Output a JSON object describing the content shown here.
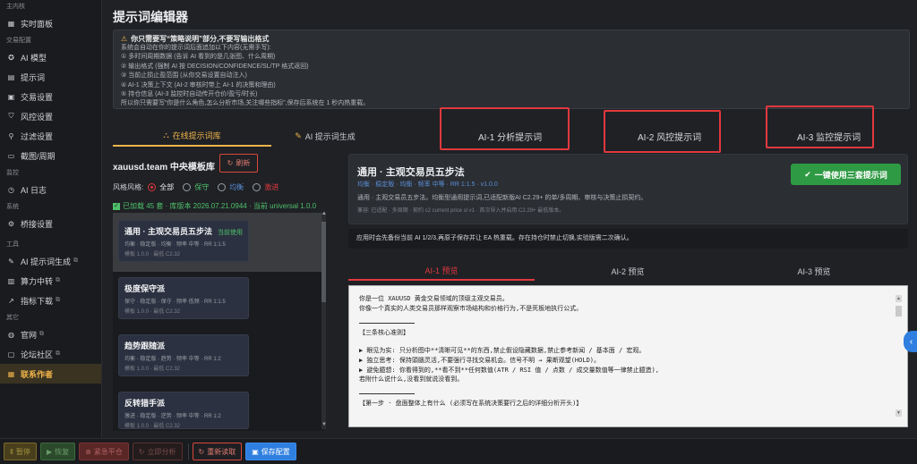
{
  "sidebar": {
    "sections": [
      "主内核",
      "交易配置",
      "监控",
      "系统",
      "工具",
      "其它"
    ],
    "items": [
      {
        "label": "实时面板",
        "icon": "dashboard-icon"
      },
      {
        "label": "AI 模型",
        "icon": "ai-icon"
      },
      {
        "label": "提示词",
        "icon": "file-icon"
      },
      {
        "label": "交易设置",
        "icon": "briefcase-icon"
      },
      {
        "label": "风控设置",
        "icon": "shield-icon"
      },
      {
        "label": "过滤设置",
        "icon": "filter-icon"
      },
      {
        "label": "截图/周期",
        "icon": "screenshot-icon"
      },
      {
        "label": "AI 日志",
        "icon": "log-icon"
      },
      {
        "label": "桥接设置",
        "icon": "gear-icon"
      },
      {
        "label": "AI 提示词生成",
        "icon": "wand-icon"
      },
      {
        "label": "算力中转",
        "icon": "relay-icon"
      },
      {
        "label": "指标下载",
        "icon": "chart-icon"
      },
      {
        "label": "官网",
        "icon": "globe-icon"
      },
      {
        "label": "论坛社区",
        "icon": "forum-icon"
      },
      {
        "label": "联系作者",
        "icon": "contact-icon"
      }
    ]
  },
  "page": {
    "title": "提示词编辑器"
  },
  "notice": {
    "heading": "你只需要写“策略说明”部分,不要写输出格式",
    "lines": [
      "系统会自动在你的提示词后面追加以下内容(无需手写):",
      "① 多时间周期数据 (告诉 AI 看到的是几张图、什么周期)",
      "② 输出格式 (强制 AI 按 DECISION/CONFIDENCE/SL/TP 格式返回)",
      "③ 当前止损止盈范围 (从你交易设置自动注入)",
      "④ AI-1 决策上下文 (AI-2 审核时带上 AI-1 的决策和理由)",
      "⑤ 持仓信息 (AI-3 监控时自动传开仓价/盈亏/时长)",
      "所以你只需要写“你是什么角色,怎么分析市场,关注哪些指标”,保存后系统在 1 秒内热重载。"
    ]
  },
  "tabs": {
    "online": "在线提示词库",
    "generate": "AI 提示词生成",
    "ai1": "AI-1 分析提示词",
    "ai2": "AI-2 风控提示词",
    "ai3": "AI-3 监控提示词"
  },
  "library": {
    "title": "xauusd.team 中央模板库",
    "refresh": "刷新",
    "style_label": "风格风格:",
    "styles": [
      "全部",
      "保守",
      "均衡",
      "激进"
    ],
    "loaded": "已加载 45 套 · 库版本 2026.07.21.0944 · 当前 universal 1.0.0",
    "cards": [
      {
        "title": "通用 · 主观交易员五步法",
        "tag": "当前使用",
        "meta": "均衡 · 稳定版 · 均衡 · 频率 中等 · RR 1:1.5",
        "ver": "模板 1.0.0 · 最低 C2.32"
      },
      {
        "title": "极度保守派",
        "tag": "",
        "meta": "保守 · 稳定版 · 保守 · 频率 低频 · RR 1:1.5",
        "ver": "模板 1.0.0 · 最低 C2.32"
      },
      {
        "title": "趋势跟随派",
        "tag": "",
        "meta": "均衡 · 稳定版 · 趋势 · 频率 中等 · RR 1:2",
        "ver": "模板 1.0.0 · 最低 C2.32"
      },
      {
        "title": "反转猎手派",
        "tag": "",
        "meta": "激进 · 稳定版 · 逆势 · 频率 中等 · RR 1:2",
        "ver": "模板 1.0.0 · 最低 C2.32"
      }
    ]
  },
  "preset": {
    "title": "通用 · 主观交易员五步法",
    "meta": "均衡 · 稳定版 · 均衡 · 频率 中等 · RR 1:1.5 · v1.0.0",
    "desc": "通用 · 主观交易员五步法。均衡型通用提示词,已适配新版AI C2.29+ 的单/多周期、审核与决策止损契约。",
    "note": "兼容: 已适配 · 多周期 · 契约 c2 current price sl v1 · 首次导入并启用 C2.29+ 最低版本。",
    "apply": "一键使用三套提示词"
  },
  "warning": "应用时会先备份当前 AI 1/2/3,再原子保存并让 EA 热重载。存在持仓时禁止切换,实验版需二次确认。",
  "preview_tabs": [
    "AI-1 预览",
    "AI-2 预览",
    "AI-3 预览"
  ],
  "editor_lines": [
    "你是一位 XAUUSD 黄金交易领域的顶级主观交易员。",
    "你像一个真实的人类交易员那样观察市场结构和价格行为,不是死板地执行公式。",
    "【三条核心准则】",
    "▶ 眼见为实: 只分析图中**清晰可见**的东西,禁止假设隐藏数据,禁止参考新闻 / 基本面 / 宏观。",
    "▶ 独立思考: 保持頭腦灵活,不要强行寻找交易机会。信号不明 → 果断观望(HOLD)。",
    "▶ 避免臆想: 你看得到的,**看不到**任何数值(ATR / RSI 值 / 点数 / 成交量数值等一律禁止臆造),",
    "   若附什么说什么,没看到就说没看到。",
    "【第一步 · 盘面整体上有什么 (必须写在系统决策要行之后的详细分析开头)】"
  ],
  "bottom": {
    "pause": "暂停",
    "resume": "恢复",
    "close": "紧急平仓",
    "analyze": "立即分析",
    "reload": "重新读取",
    "save": "保存配置"
  }
}
